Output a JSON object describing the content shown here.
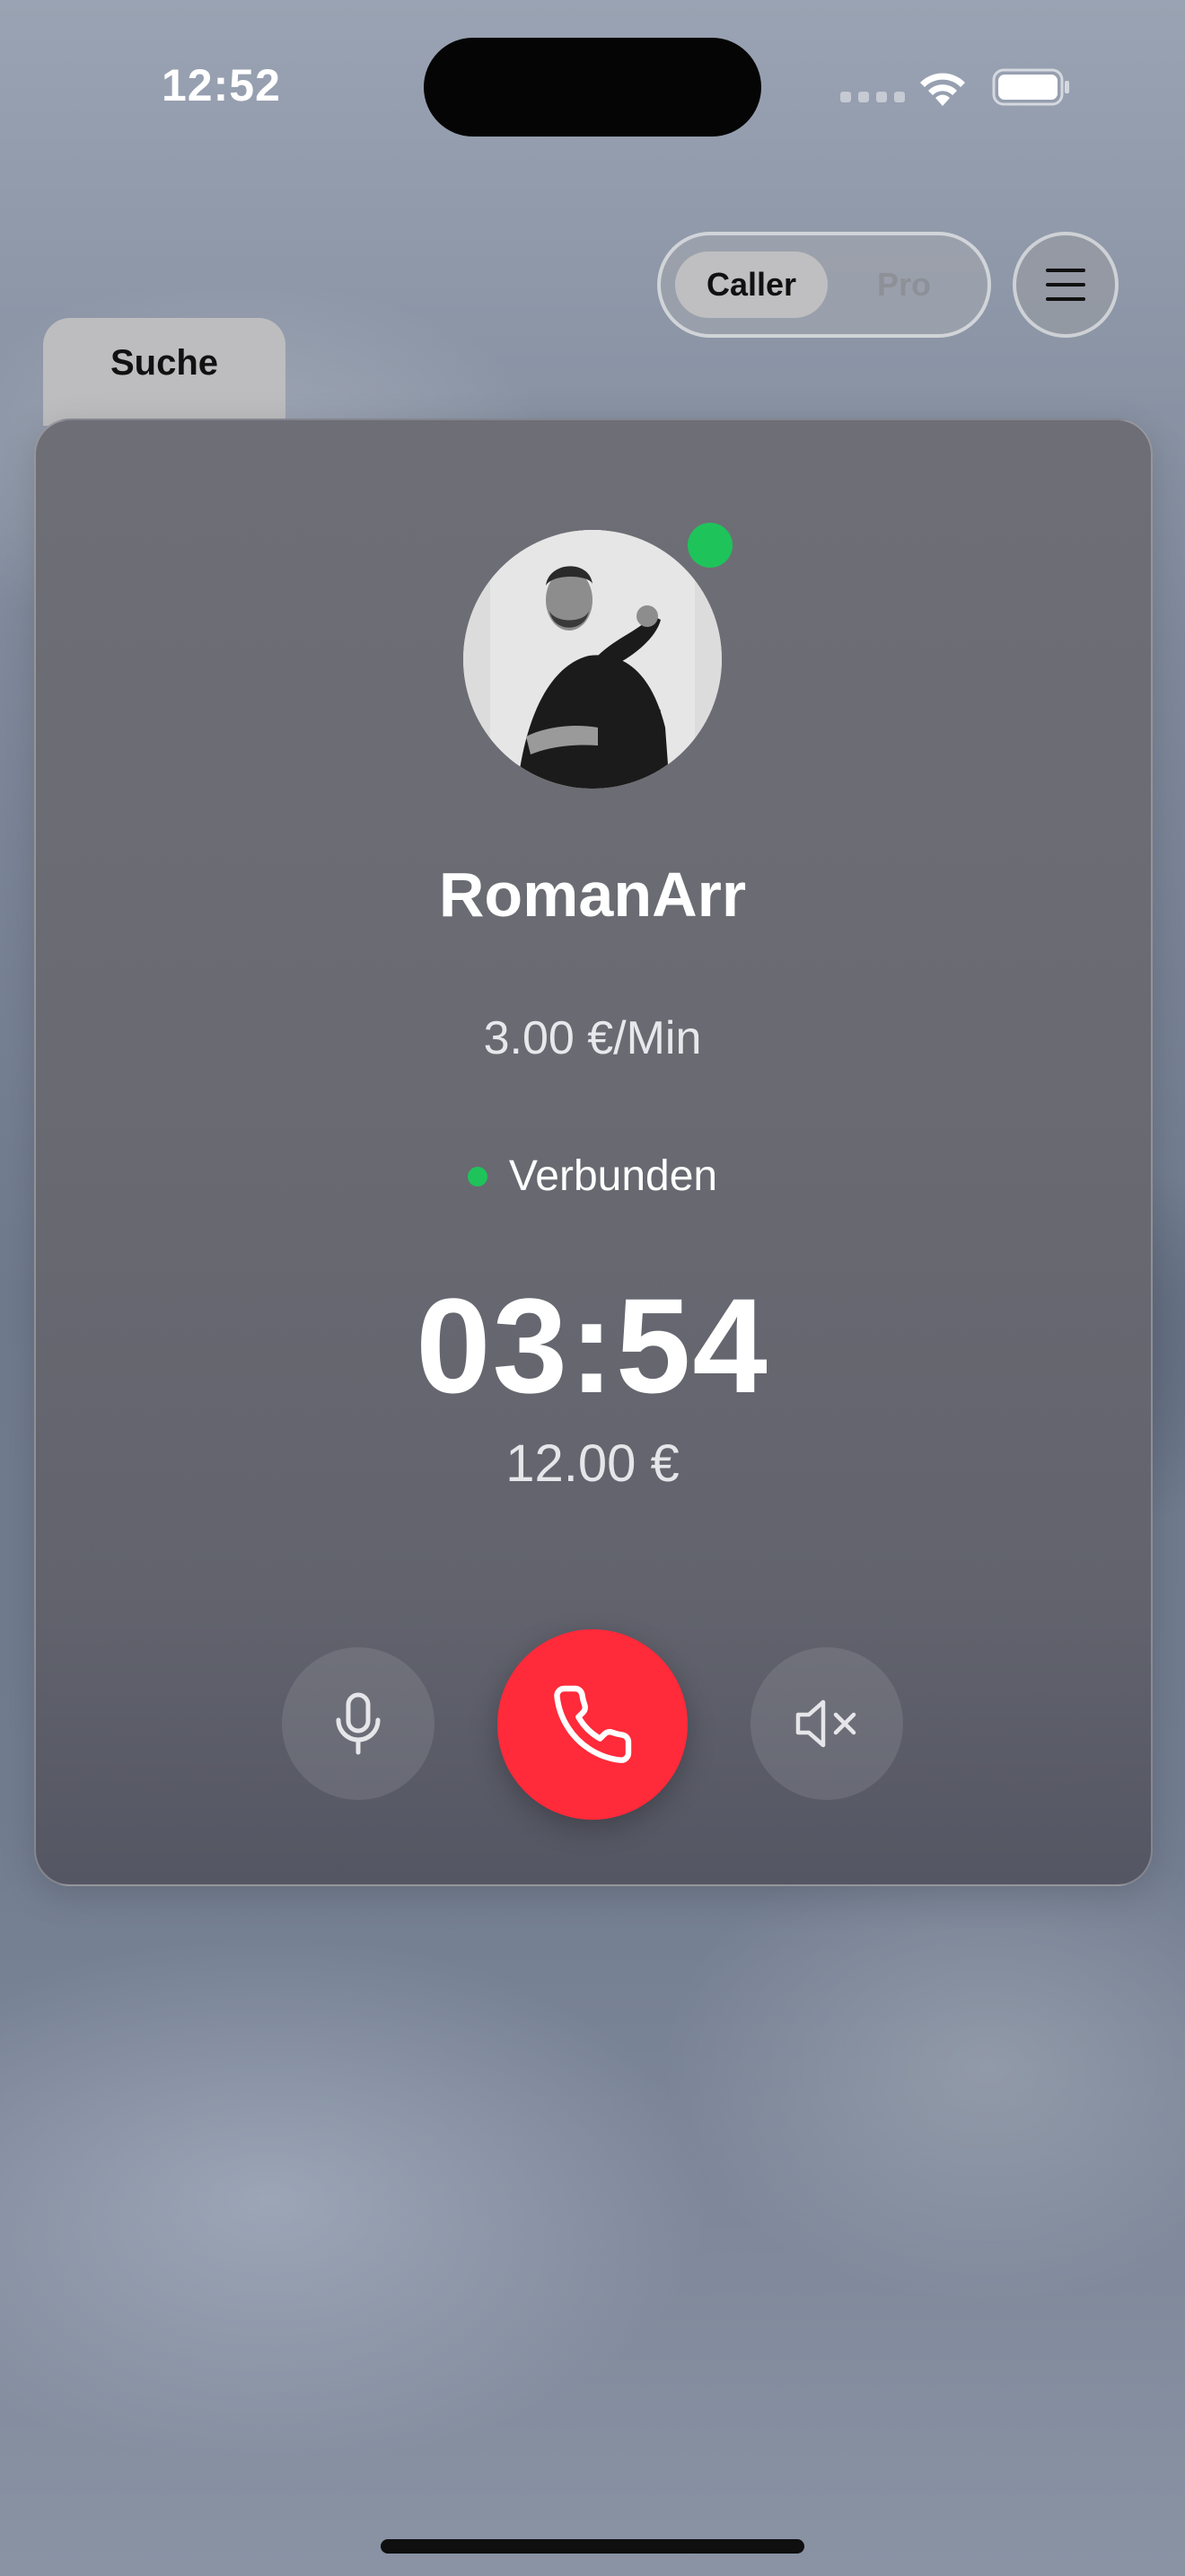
{
  "status_bar": {
    "time": "12:52"
  },
  "segmented": {
    "options": [
      "Caller",
      "Pro"
    ],
    "selected": "Caller"
  },
  "tabs": {
    "search_label": "Suche"
  },
  "call": {
    "name": "RomanArr",
    "rate": "3.00 €/Min",
    "status": "Verbunden",
    "timer": "03:54",
    "cost": "12.00 €"
  },
  "icons": {
    "menu": "hamburger-menu-icon",
    "mic": "microphone-icon",
    "end_call": "phone-icon",
    "speaker": "speaker-muted-icon"
  },
  "colors": {
    "online": "#1ec45a",
    "end_call": "#ff2a3a",
    "card": "#6a6a72"
  }
}
